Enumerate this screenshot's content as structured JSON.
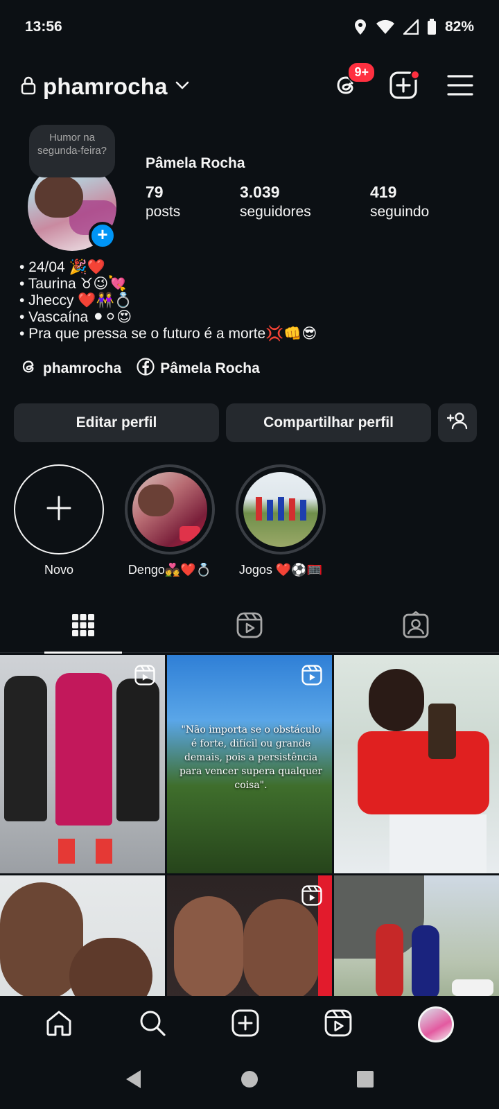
{
  "status_bar": {
    "time": "13:56",
    "battery": "82%"
  },
  "header": {
    "username": "phamrocha",
    "notifications_badge": "9+"
  },
  "note": {
    "text": "Humor na segunda-feira?"
  },
  "profile": {
    "full_name": "Pâmela Rocha",
    "stats": [
      {
        "value": "79",
        "label": "posts"
      },
      {
        "value": "3.039",
        "label": "seguidores"
      },
      {
        "value": "419",
        "label": "seguindo"
      }
    ],
    "bio": [
      "•  24/04 🎉❤️",
      "• Taurina ♉😉💘",
      "• Jheccy ❤️👭💍",
      "• Vascaína ⚫⚪😍",
      "• Pra que pressa se o futuro é a morte💢👊😎"
    ],
    "links": {
      "threads_label": "phamrocha",
      "facebook_label": "Pâmela Rocha"
    }
  },
  "actions": {
    "edit_label": "Editar perfil",
    "share_label": "Compartilhar perfil"
  },
  "highlights": [
    {
      "label": "Novo"
    },
    {
      "label": "Dengo💑❤️💍"
    },
    {
      "label": "Jogos ❤️⚽🥅"
    }
  ],
  "tabs": [
    "grid-icon",
    "reels-icon",
    "tagged-icon"
  ],
  "grid": {
    "quote_text": "\"Não importa se o obstáculo é forte, difícil ou grande demais, pois a persistência para vencer supera qualquer coisa\"."
  },
  "colors": {
    "background": "#0c1014",
    "accent_blue": "#0095f6",
    "badge_red": "#ff3040",
    "button_bg": "#25292e"
  }
}
